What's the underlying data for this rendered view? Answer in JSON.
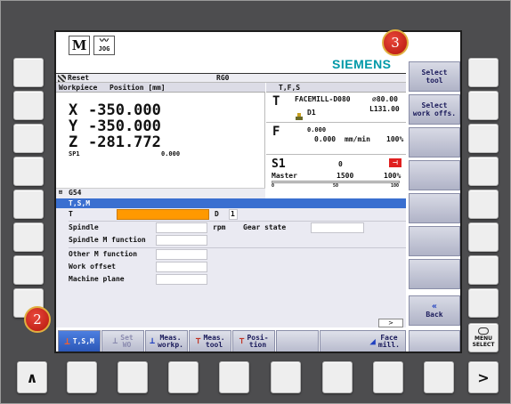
{
  "header": {
    "mode_icon": "M",
    "jog_top": "〰",
    "jog_label": "JOG",
    "brand": "SIEMENS",
    "channel_status": "Reset",
    "program": "RG0"
  },
  "position": {
    "title": "Workpiece",
    "subtitle": "Position [mm]",
    "axes": [
      {
        "name": "X",
        "value": "-350.000"
      },
      {
        "name": "Y",
        "value": "-350.000"
      },
      {
        "name": "Z",
        "value": "-281.772"
      }
    ],
    "spindle_label": "SP1",
    "spindle_value": "0.000",
    "work_offset": "G54"
  },
  "tfs": {
    "title": "T,F,S",
    "tool_name": "FACEMILL-D080",
    "tool_diameter": "⌀80.00",
    "tool_length": "L131.00",
    "cutting_edge": "D1",
    "feed_value1": "0.000",
    "feed_value2": "0.000",
    "feed_unit": "mm/min",
    "feed_percent": "100%",
    "spindle_title": "S1",
    "spindle_speed": "0",
    "spindle_master": "Master",
    "spindle_max": "1500",
    "spindle_percent": "100%",
    "scale": [
      "0",
      "50",
      "100"
    ]
  },
  "tsm": {
    "title": "T,S,M",
    "t_label": "T",
    "d_label": "D",
    "d_value": "1",
    "spindle_label": "Spindle",
    "rpm": "rpm",
    "gear_label": "Gear state",
    "spindle_m_label": "Spindle M function",
    "other_m_label": "Other M function",
    "work_offset_label": "Work offset",
    "machine_plane_label": "Machine plane"
  },
  "vsoftkeys": [
    {
      "line1": "Select",
      "line2": "tool"
    },
    {
      "line1": "Select",
      "line2": "work offs."
    },
    {
      "line1": "",
      "line2": ""
    },
    {
      "line1": "",
      "line2": ""
    },
    {
      "line1": "",
      "line2": ""
    },
    {
      "line1": "",
      "line2": ""
    },
    {
      "line1": "",
      "line2": ""
    },
    {
      "line1": "",
      "line2": ""
    }
  ],
  "back": "Back",
  "hsoftkeys": [
    {
      "line1": "T,S,M",
      "line2": ""
    },
    {
      "line1": "Set",
      "line2": "WO"
    },
    {
      "line1": "Meas.",
      "line2": "workp."
    },
    {
      "line1": "Meas.",
      "line2": "tool"
    },
    {
      "line1": "Posi-",
      "line2": "tion"
    },
    {
      "line1": "",
      "line2": ""
    },
    {
      "line1": "Face",
      "line2": "mill."
    },
    {
      "line1": "",
      "line2": ""
    }
  ],
  "frame_keys": {
    "menu_select_line1": "MENU",
    "menu_select_line2": "SELECT",
    "scroll_left": "∧",
    "scroll_right": ">"
  },
  "callouts": [
    "2",
    "3"
  ],
  "colors": {
    "selection": "#3a6fd0",
    "active_field": "#ff9900",
    "brand": "#0099a8"
  }
}
